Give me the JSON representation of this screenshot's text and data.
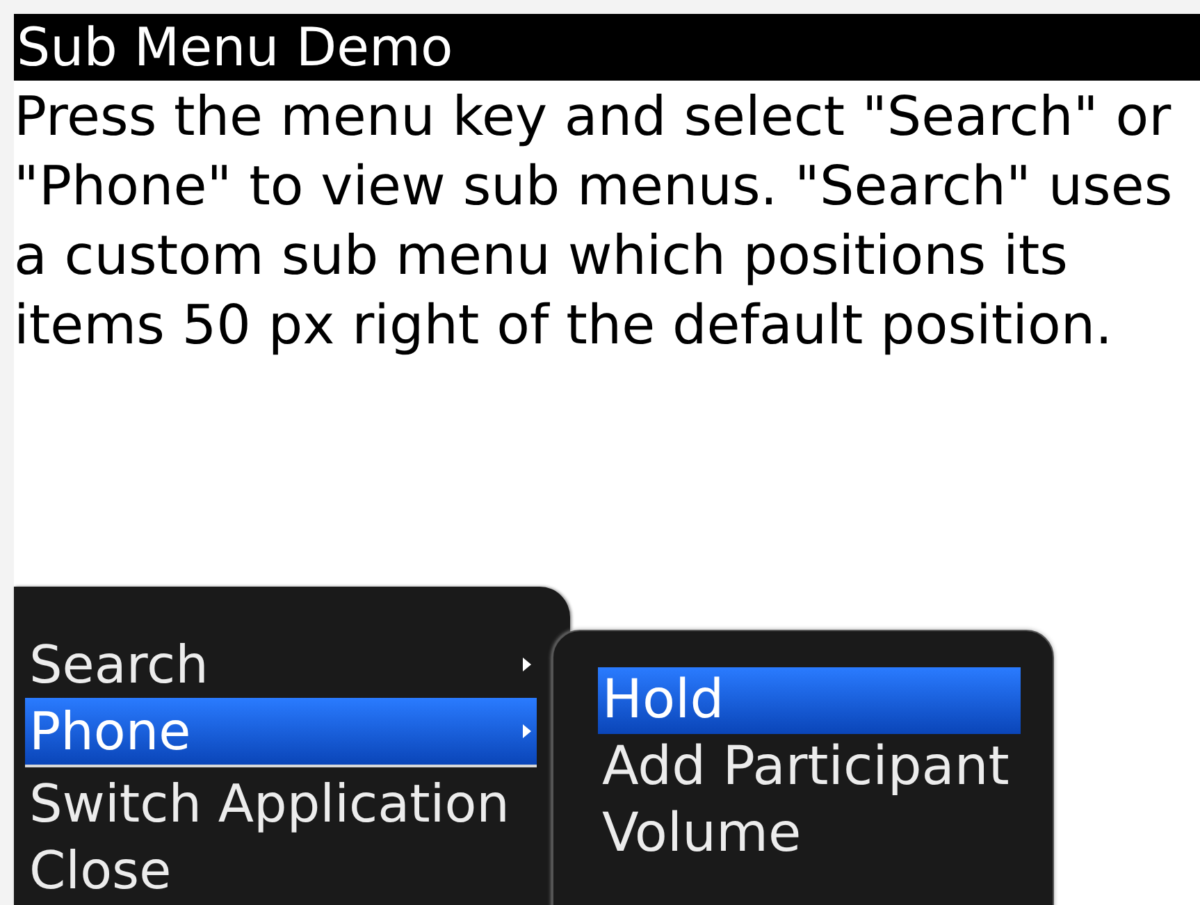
{
  "window": {
    "title": "Sub Menu Demo"
  },
  "description": "Press the menu key and select \"Search\" or \"Phone\" to view sub menus. \"Search\" uses a custom sub menu which positions its items 50 px right of the default position.",
  "menu": {
    "items": [
      {
        "label": "Search",
        "selected": false,
        "has_submenu": true,
        "separator_after": false
      },
      {
        "label": "Phone",
        "selected": true,
        "has_submenu": true,
        "separator_after": true
      },
      {
        "label": "Switch Application",
        "selected": false,
        "has_submenu": false,
        "separator_after": false
      },
      {
        "label": "Close",
        "selected": false,
        "has_submenu": false,
        "separator_after": false
      }
    ]
  },
  "submenu": {
    "items": [
      {
        "label": "Hold",
        "selected": true
      },
      {
        "label": "Add Participant",
        "selected": false
      },
      {
        "label": "Volume",
        "selected": false
      }
    ]
  }
}
